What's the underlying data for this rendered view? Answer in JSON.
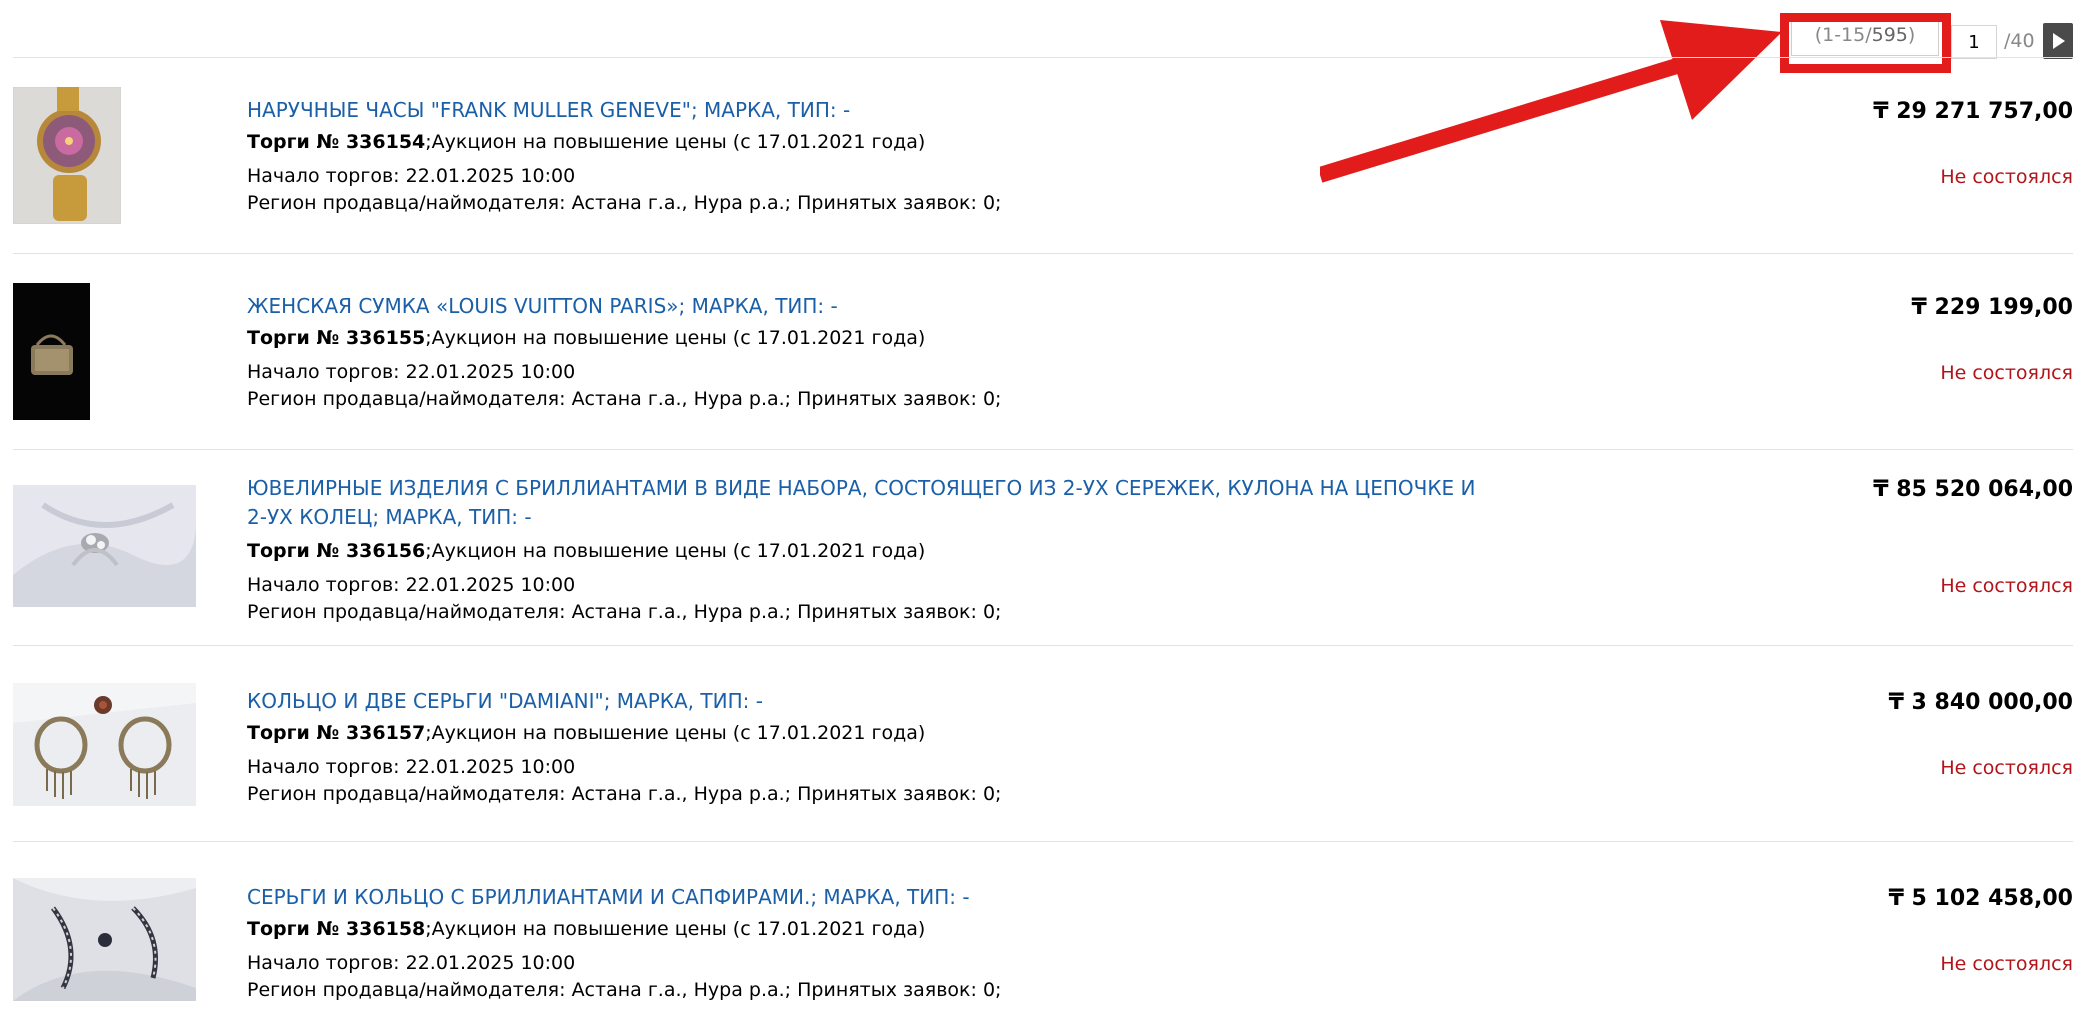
{
  "pager": {
    "range_prefix": "(1-15/",
    "range_total": "595",
    "range_suffix": ")",
    "page_value": "1",
    "page_total": "/40",
    "next_icon": "play-triangle-icon"
  },
  "colors": {
    "link": "#1a5fa8",
    "status": "#b3141a",
    "annotation": "#e21b1b"
  },
  "labels": {
    "lot_prefix": "Торги № ",
    "start_label": "Начало торгов:",
    "region_label": "Регион продавца/наймодателя:",
    "region_value": "Астана г.а., Нура р.а.;",
    "bids_label": "Принятых заявок:",
    "bids_value": "0;"
  },
  "items": [
    {
      "title": "НАРУЧНЫЕ ЧАСЫ \"FRANK MULLER GENEVE\"; МАРКА, ТИП: -",
      "lot_number": "336154",
      "auction_type": ";Аукцион на повышение цены (с 17.01.2021 года)",
      "start_date": "22.01.2025 10:00",
      "price": "₸ 29 271 757,00",
      "status": "Не состоялся",
      "thumb_icon": "watch-photo-icon"
    },
    {
      "title": "ЖЕНСКАЯ СУМКА «LOUIS VUITTON PARIS»; МАРКА, ТИП: -",
      "lot_number": "336155",
      "auction_type": ";Аукцион на повышение цены (с 17.01.2021 года)",
      "start_date": "22.01.2025 10:00",
      "price": "₸ 229 199,00",
      "status": "Не состоялся",
      "thumb_icon": "handbag-photo-icon"
    },
    {
      "title": "ЮВЕЛИРНЫЕ ИЗДЕЛИЯ С БРИЛЛИАНТАМИ В ВИДЕ НАБОРА, СОСТОЯЩЕГО ИЗ 2-УХ СЕРЕЖЕК, КУЛОНА НА ЦЕПОЧКЕ И 2-УХ КОЛЕЦ; МАРКА, ТИП: -",
      "lot_number": "336156",
      "auction_type": ";Аукцион на повышение цены (с 17.01.2021 года)",
      "start_date": "22.01.2025 10:00",
      "price": "₸ 85 520 064,00",
      "status": "Не состоялся",
      "thumb_icon": "jewelry-set-photo-icon"
    },
    {
      "title": "КОЛЬЦО И ДВЕ СЕРЬГИ \"DAMIANI\"; МАРКА, ТИП: -",
      "lot_number": "336157",
      "auction_type": ";Аукцион на повышение цены (с 17.01.2021 года)",
      "start_date": "22.01.2025 10:00",
      "price": "₸ 3 840 000,00",
      "status": "Не состоялся",
      "thumb_icon": "earrings-photo-icon"
    },
    {
      "title": "СЕРЬГИ И КОЛЬЦО С БРИЛЛИАНТАМИ И САПФИРАМИ.; МАРКА, ТИП: -",
      "lot_number": "336158",
      "auction_type": ";Аукцион на повышение цены (с 17.01.2021 года)",
      "start_date": "22.01.2025 10:00",
      "price": "₸ 5 102 458,00",
      "status": "Не состоялся",
      "thumb_icon": "sapphire-earrings-photo-icon"
    }
  ]
}
